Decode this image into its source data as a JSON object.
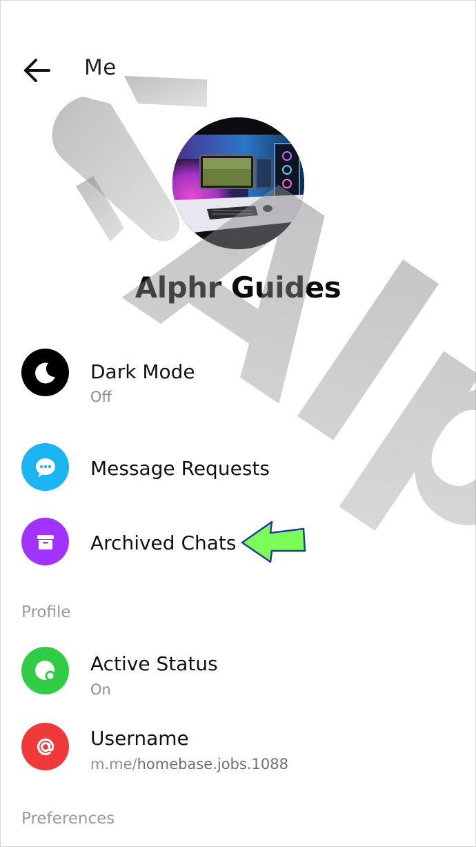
{
  "header": {
    "title": "Me",
    "back_icon": "arrow-left-icon"
  },
  "profile": {
    "name": "Alphr Guides",
    "avatar": "desk-setup-photo"
  },
  "menu_items": [
    {
      "title": "Dark Mode",
      "subtitle": "Off",
      "icon": "moon-icon",
      "color": "#000000"
    },
    {
      "title": "Message Requests",
      "icon": "chat-bubble-icon",
      "color": "#1ab4f2"
    },
    {
      "title": "Archived Chats",
      "icon": "archive-box-icon",
      "color": "#a033ff"
    }
  ],
  "sections": {
    "profile": "Profile",
    "preferences": "Preferences"
  },
  "profile_items": [
    {
      "title": "Active Status",
      "subtitle": "On",
      "icon": "active-dot-icon",
      "color": "#31cc46"
    },
    {
      "title": "Username",
      "subtitle_prefix": "m.me/",
      "subtitle_value": "homebase.jobs.1088",
      "icon": "at-sign-icon",
      "color": "#f0393b"
    }
  ],
  "watermark": "Alphr",
  "annotation": {
    "color": "#7cfc57"
  }
}
